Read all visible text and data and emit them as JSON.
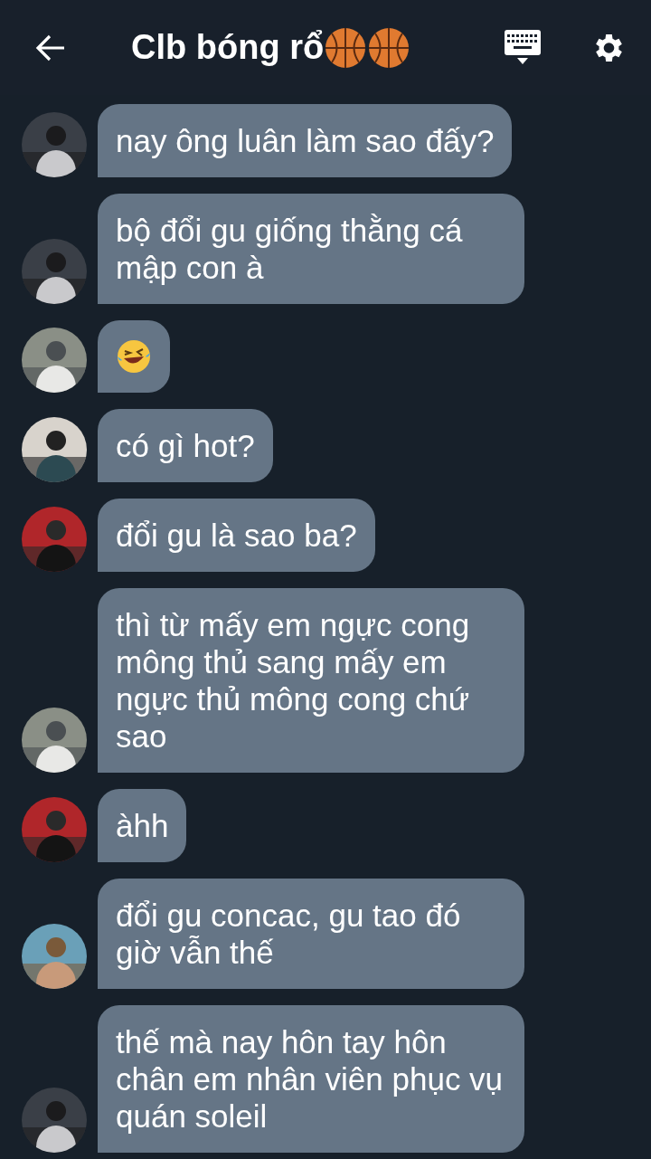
{
  "header": {
    "title": "Clb bóng rổ"
  },
  "messages": [
    {
      "kind": "text",
      "text": "nay ông luân làm sao đấy?"
    },
    {
      "kind": "text",
      "text": "bộ đổi gu giống thằng cá mập con à"
    },
    {
      "kind": "emoji"
    },
    {
      "kind": "text",
      "text": "có gì hot?"
    },
    {
      "kind": "text",
      "text": "đổi gu là sao ba?"
    },
    {
      "kind": "text",
      "text": "thì từ mấy em ngực cong mông thủ sang mấy em ngực thủ mông cong chứ sao"
    },
    {
      "kind": "text",
      "text": "àhh"
    },
    {
      "kind": "text",
      "text": "đổi gu concac, gu tao đó giờ vẫn thế"
    },
    {
      "kind": "text",
      "text": "thế mà nay hôn tay hôn chân em nhân viên phục vụ quán soleil"
    }
  ]
}
